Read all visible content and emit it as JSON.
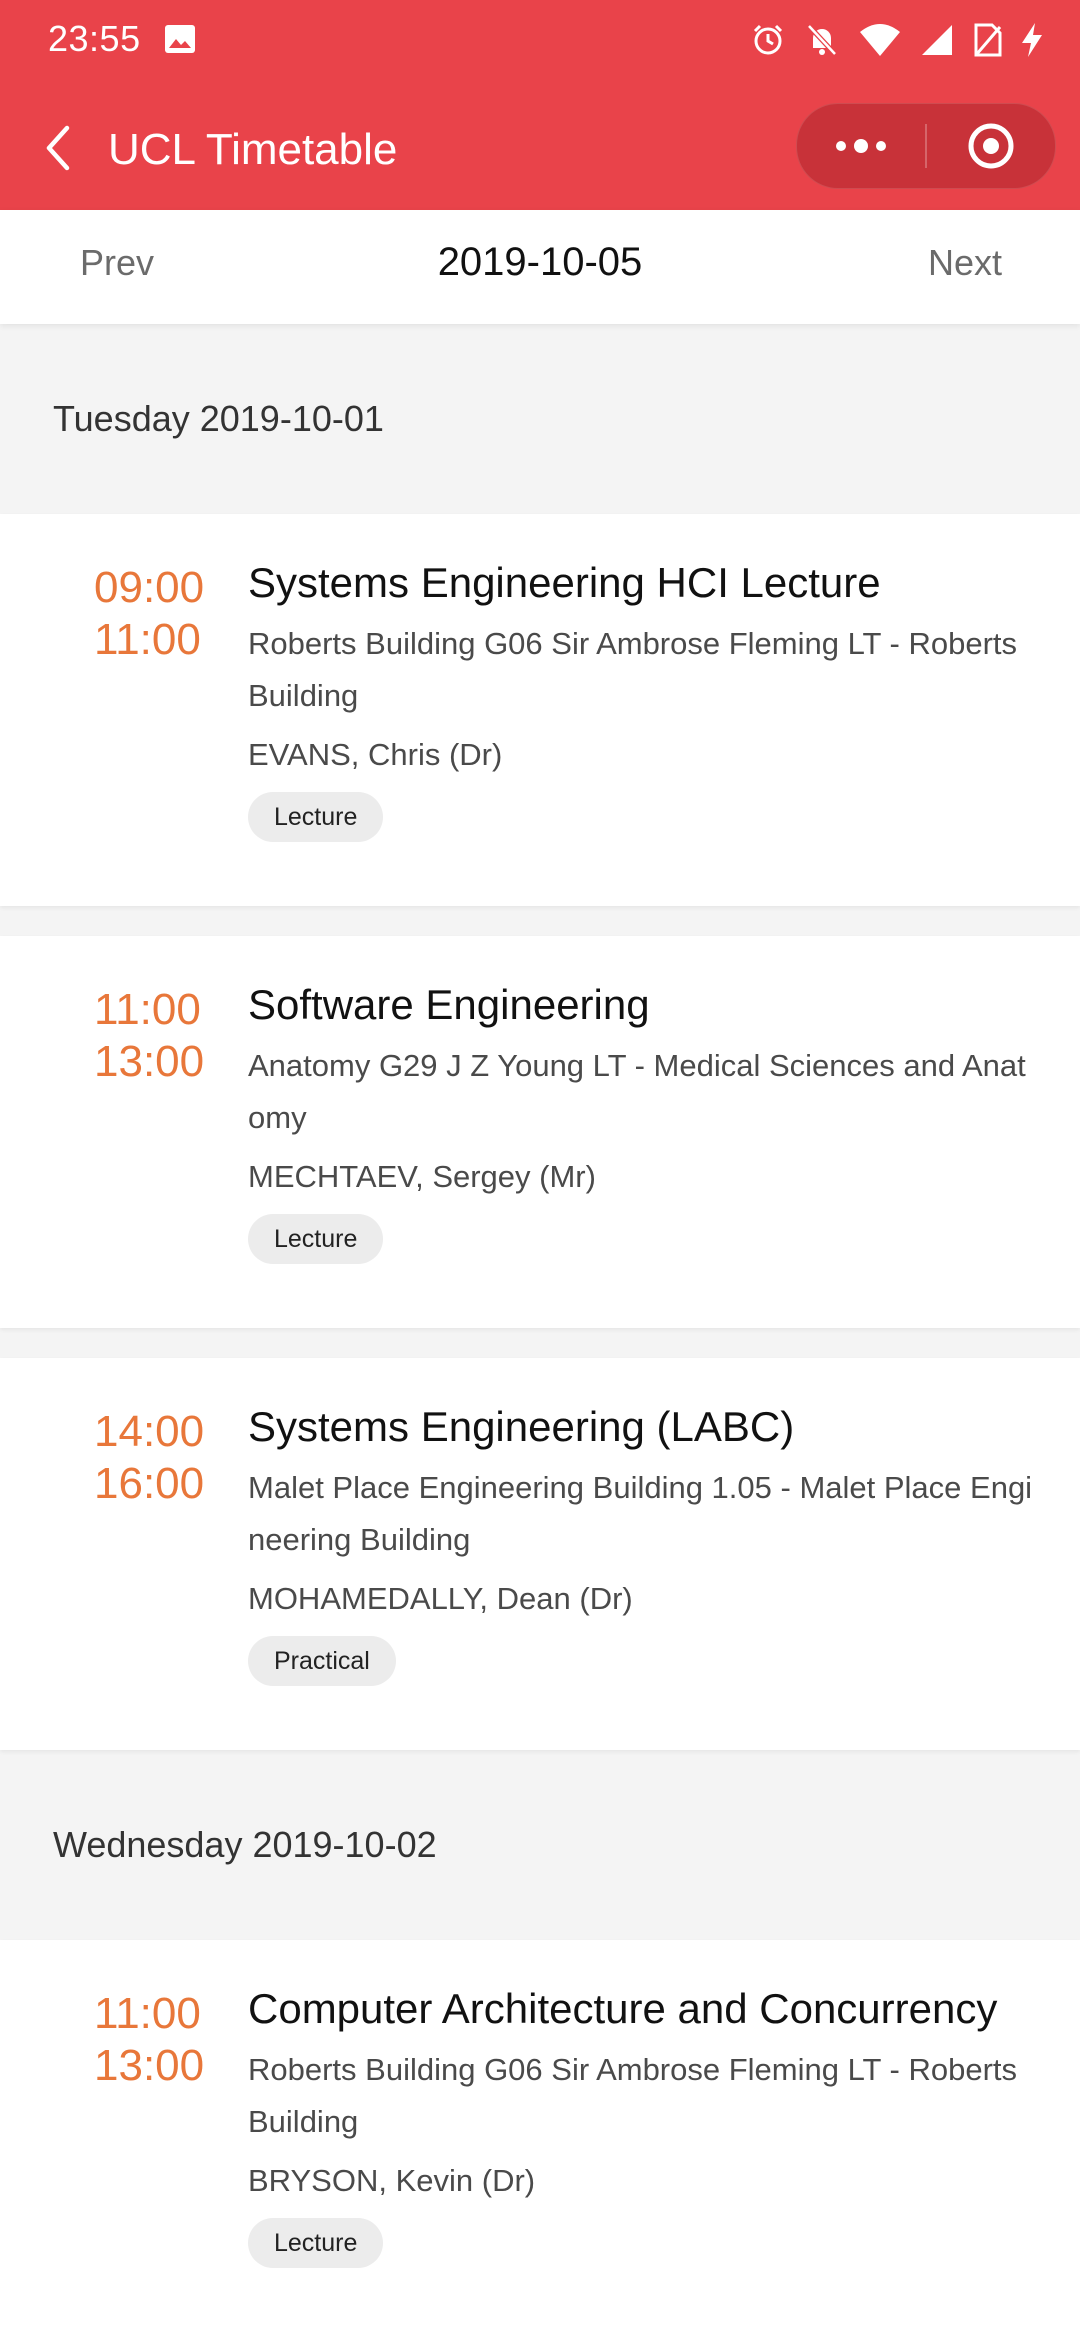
{
  "status": {
    "time": "23:55"
  },
  "header": {
    "title": "UCL Timetable",
    "accent_color": "#e9434a"
  },
  "datenav": {
    "prev_label": "Prev",
    "current_date": "2019-10-05",
    "next_label": "Next"
  },
  "days": [
    {
      "label": "Tuesday 2019-10-01",
      "events": [
        {
          "start": "09:00",
          "end": "11:00",
          "title": "Systems Engineering HCI Lecture",
          "location": "Roberts Building G06 Sir Ambrose Fleming LT - Roberts Building",
          "teacher": "EVANS, Chris (Dr)",
          "type": "Lecture"
        },
        {
          "start": "11:00",
          "end": "13:00",
          "title": "Software Engineering",
          "location": "Anatomy G29 J Z Young LT - Medical Sciences and Anatomy",
          "teacher": "MECHTAEV, Sergey (Mr)",
          "type": "Lecture"
        },
        {
          "start": "14:00",
          "end": "16:00",
          "title": "Systems Engineering (LABC)",
          "location": "Malet Place Engineering Building 1.05 - Malet Place Engineering Building",
          "teacher": "MOHAMEDALLY, Dean (Dr)",
          "type": "Practical"
        }
      ]
    },
    {
      "label": "Wednesday 2019-10-02",
      "events": [
        {
          "start": "11:00",
          "end": "13:00",
          "title": "Computer Architecture and Concurrency",
          "location": "Roberts Building G06 Sir Ambrose Fleming LT - Roberts Building",
          "teacher": "BRYSON, Kevin (Dr)",
          "type": "Lecture"
        }
      ]
    }
  ]
}
